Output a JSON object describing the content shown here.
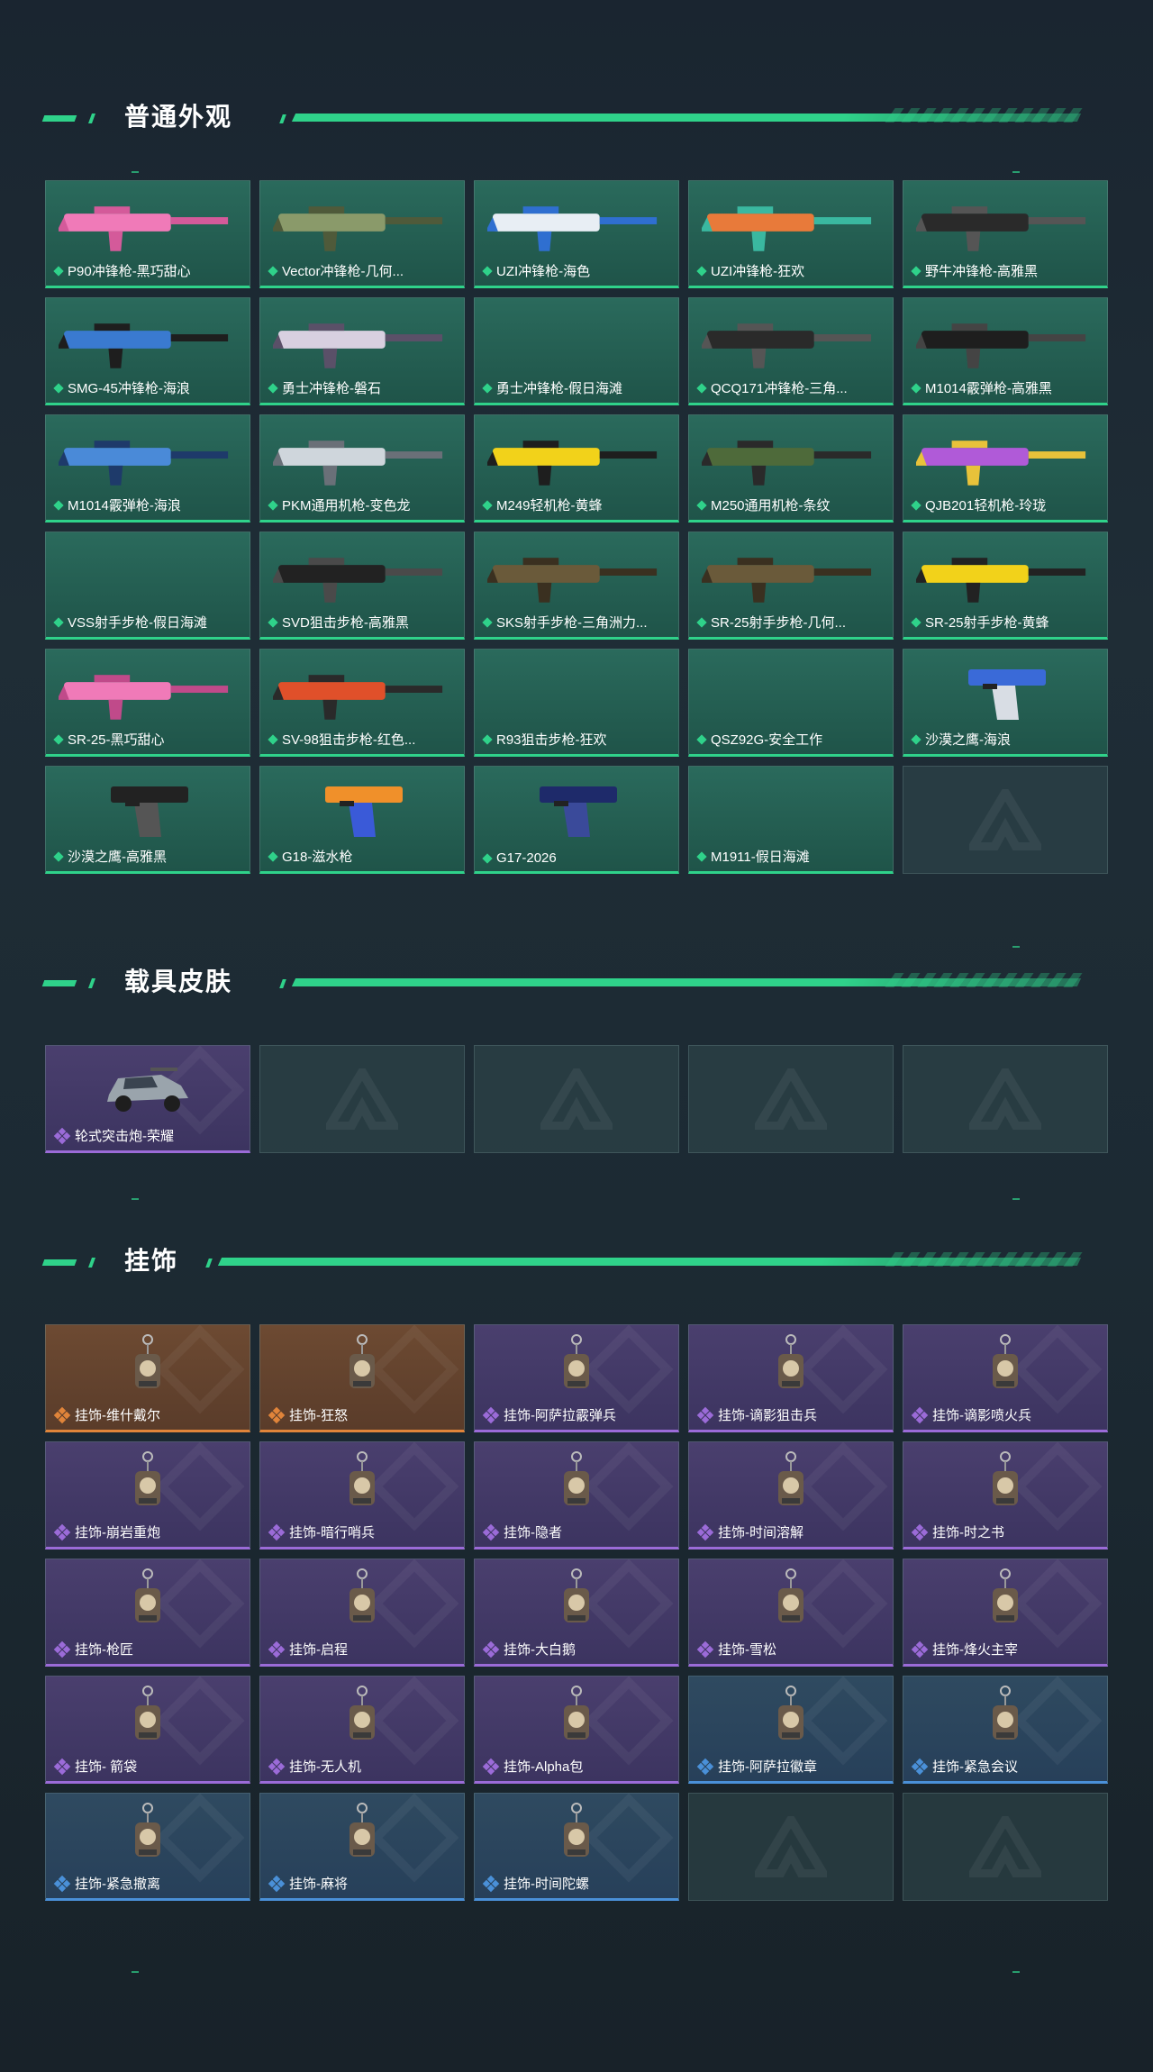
{
  "colors": {
    "accent": "#2fd28a",
    "purple": "#9b6bd8",
    "orange": "#e0843a",
    "blue": "#4a90d8"
  },
  "sections": {
    "weapons": {
      "title": "普通外观",
      "items": [
        {
          "label": "P90冲锋枪-黑巧甜心",
          "rarity": "green",
          "icon": "pink-smg"
        },
        {
          "label": "Vector冲锋枪-几何...",
          "rarity": "green",
          "icon": "camo-smg"
        },
        {
          "label": "UZI冲锋枪-海色",
          "rarity": "green",
          "icon": "white-smg"
        },
        {
          "label": "UZI冲锋枪-狂欢",
          "rarity": "green",
          "icon": "colorful-smg"
        },
        {
          "label": "野牛冲锋枪-高雅黑",
          "rarity": "green",
          "icon": "black-smg"
        },
        {
          "label": "SMG-45冲锋枪-海浪",
          "rarity": "green",
          "icon": "blue-smg"
        },
        {
          "label": "勇士冲锋枪-磐石",
          "rarity": "green",
          "icon": "marble-smg"
        },
        {
          "label": "勇士冲锋枪-假日海滩",
          "rarity": "green",
          "icon": ""
        },
        {
          "label": "QCQ171冲锋枪-三角...",
          "rarity": "green",
          "icon": "black-smg"
        },
        {
          "label": "M1014霰弹枪-高雅黑",
          "rarity": "green",
          "icon": "black-shotgun"
        },
        {
          "label": "M1014霰弹枪-海浪",
          "rarity": "green",
          "icon": "blue-shotgun"
        },
        {
          "label": "PKM通用机枪-变色龙",
          "rarity": "green",
          "icon": "white-mg"
        },
        {
          "label": "M249轻机枪-黄蜂",
          "rarity": "green",
          "icon": "yellow-mg"
        },
        {
          "label": "M250通用机枪-条纹",
          "rarity": "green",
          "icon": "camo-mg"
        },
        {
          "label": "QJB201轻机枪-玲珑",
          "rarity": "green",
          "icon": "purple-mg"
        },
        {
          "label": "VSS射手步枪-假日海滩",
          "rarity": "green",
          "icon": ""
        },
        {
          "label": "SVD狙击步枪-高雅黑",
          "rarity": "green",
          "icon": "black-sniper"
        },
        {
          "label": "SKS射手步枪-三角洲力...",
          "rarity": "green",
          "icon": "camo-rifle"
        },
        {
          "label": "SR-25射手步枪-几何...",
          "rarity": "green",
          "icon": "camo-rifle"
        },
        {
          "label": "SR-25射手步枪-黄蜂",
          "rarity": "green",
          "icon": "yellow-rifle"
        },
        {
          "label": "SR-25-黑巧甜心",
          "rarity": "green",
          "icon": "pink-rifle"
        },
        {
          "label": "SV-98狙击步枪-红色...",
          "rarity": "green",
          "icon": "orange-sniper"
        },
        {
          "label": "R93狙击步枪-狂欢",
          "rarity": "green",
          "icon": ""
        },
        {
          "label": "QSZ92G-安全工作",
          "rarity": "green",
          "icon": ""
        },
        {
          "label": "沙漠之鹰-海浪",
          "rarity": "green",
          "icon": "blue-pistol"
        },
        {
          "label": "沙漠之鹰-高雅黑",
          "rarity": "green",
          "icon": "black-pistol"
        },
        {
          "label": "G18-滋水枪",
          "rarity": "green",
          "icon": "orange-pistol"
        },
        {
          "label": "G17-2026",
          "rarity": "green",
          "icon": "navy-pistol"
        },
        {
          "label": "M1911-假日海滩",
          "rarity": "green",
          "icon": ""
        },
        {
          "label": "",
          "rarity": "empty",
          "icon": ""
        }
      ]
    },
    "vehicles": {
      "title": "载具皮肤",
      "items": [
        {
          "label": "轮式突击炮-荣耀",
          "rarity": "purple",
          "icon": "vehicle"
        },
        {
          "label": "",
          "rarity": "empty",
          "icon": ""
        },
        {
          "label": "",
          "rarity": "empty",
          "icon": ""
        },
        {
          "label": "",
          "rarity": "empty",
          "icon": ""
        },
        {
          "label": "",
          "rarity": "empty",
          "icon": ""
        }
      ]
    },
    "charms": {
      "title": "挂饰",
      "items": [
        {
          "label": "挂饰-维什戴尔",
          "rarity": "orange",
          "icon": "charm"
        },
        {
          "label": "挂饰-狂怒",
          "rarity": "orange",
          "icon": "charm"
        },
        {
          "label": "挂饰-阿萨拉霰弹兵",
          "rarity": "purple",
          "icon": "charm"
        },
        {
          "label": "挂饰-谪影狙击兵",
          "rarity": "purple",
          "icon": "charm"
        },
        {
          "label": "挂饰-谪影喷火兵",
          "rarity": "purple",
          "icon": "charm"
        },
        {
          "label": "挂饰-崩岩重炮",
          "rarity": "purple",
          "icon": "charm"
        },
        {
          "label": "挂饰-暗行哨兵",
          "rarity": "purple",
          "icon": "charm"
        },
        {
          "label": "挂饰-隐者",
          "rarity": "purple",
          "icon": "charm"
        },
        {
          "label": "挂饰-时间溶解",
          "rarity": "purple",
          "icon": "charm"
        },
        {
          "label": "挂饰-时之书",
          "rarity": "purple",
          "icon": "charm"
        },
        {
          "label": "挂饰-枪匠",
          "rarity": "purple",
          "icon": "charm"
        },
        {
          "label": "挂饰-启程",
          "rarity": "purple",
          "icon": "charm"
        },
        {
          "label": "挂饰-大白鹅",
          "rarity": "purple",
          "icon": "charm"
        },
        {
          "label": "挂饰-雪松",
          "rarity": "purple",
          "icon": "charm"
        },
        {
          "label": "挂饰-烽火主宰",
          "rarity": "purple",
          "icon": "charm"
        },
        {
          "label": "挂饰- 箭袋",
          "rarity": "purple",
          "icon": "charm"
        },
        {
          "label": "挂饰-无人机",
          "rarity": "purple",
          "icon": "charm"
        },
        {
          "label": "挂饰-Alpha包",
          "rarity": "purple",
          "icon": "charm"
        },
        {
          "label": "挂饰-阿萨拉徽章",
          "rarity": "blue",
          "icon": "charm"
        },
        {
          "label": "挂饰-紧急会议",
          "rarity": "blue",
          "icon": "charm"
        },
        {
          "label": "挂饰-紧急撤离",
          "rarity": "blue",
          "icon": "charm"
        },
        {
          "label": "挂饰-麻将",
          "rarity": "blue",
          "icon": "charm"
        },
        {
          "label": "挂饰-时间陀螺",
          "rarity": "blue",
          "icon": "charm"
        },
        {
          "label": "",
          "rarity": "empty",
          "icon": ""
        },
        {
          "label": "",
          "rarity": "empty",
          "icon": ""
        }
      ]
    }
  }
}
